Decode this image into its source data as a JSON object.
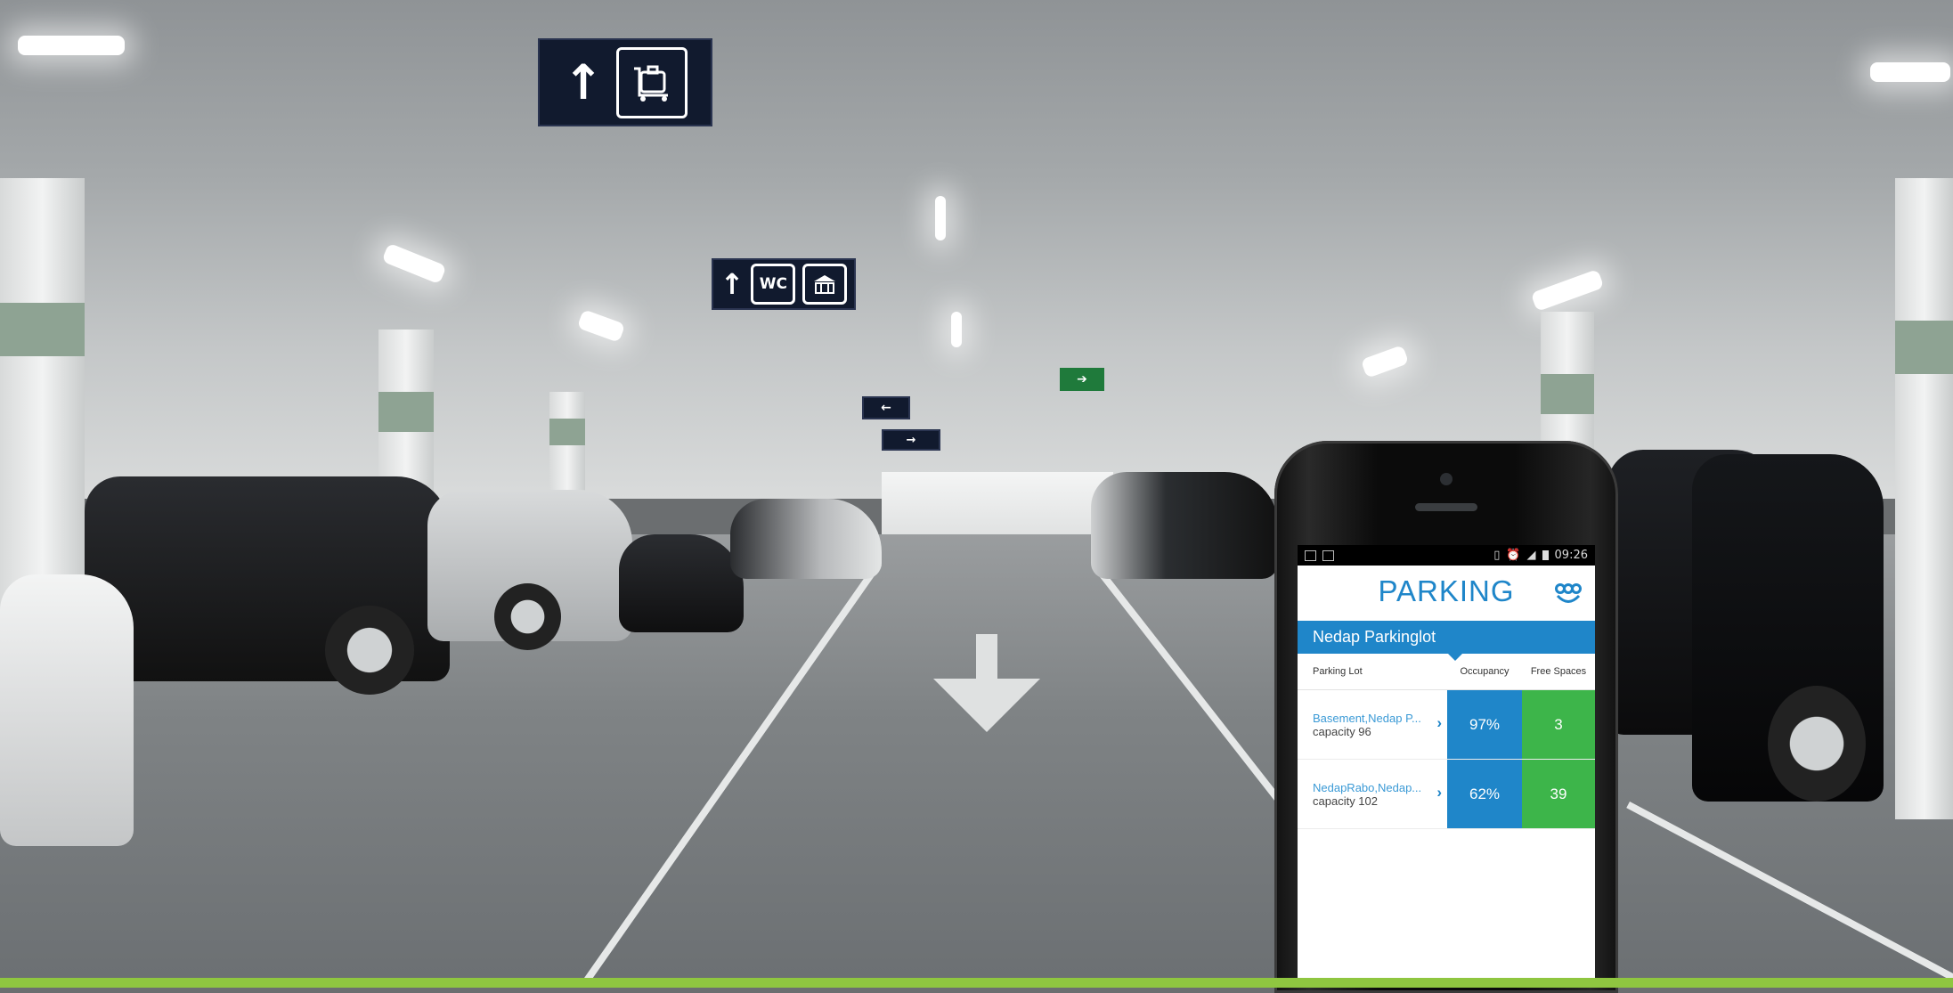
{
  "scene": {
    "signs": [
      {
        "glyph": "↑",
        "icon": "luggage-trolley-icon"
      },
      {
        "glyph": "↑",
        "text": "WC",
        "icon": "shop-icon"
      }
    ]
  },
  "phone": {
    "status_bar": {
      "time": "09:26",
      "icons": [
        "notification-icon",
        "image-icon",
        "vibrate-icon",
        "alarm-icon",
        "signal-icon",
        "battery-icon"
      ]
    },
    "app": {
      "title": "PARKING",
      "logo_icon": "nedap-logo-icon",
      "parkinglot_name": "Nedap Parkinglot",
      "columns": {
        "lot": "Parking Lot",
        "occupancy": "Occupancy",
        "free": "Free Spaces"
      },
      "rows": [
        {
          "name": "Basement,Nedap P...",
          "capacity": "capacity 96",
          "occupancy": "97%",
          "free": "3"
        },
        {
          "name": "NedapRabo,Nedap...",
          "capacity": "capacity 102",
          "occupancy": "62%",
          "free": "39"
        }
      ]
    }
  },
  "colors": {
    "brand_blue": "#1f86c9",
    "free_green": "#3db54a",
    "band_green": "#8fc640"
  }
}
